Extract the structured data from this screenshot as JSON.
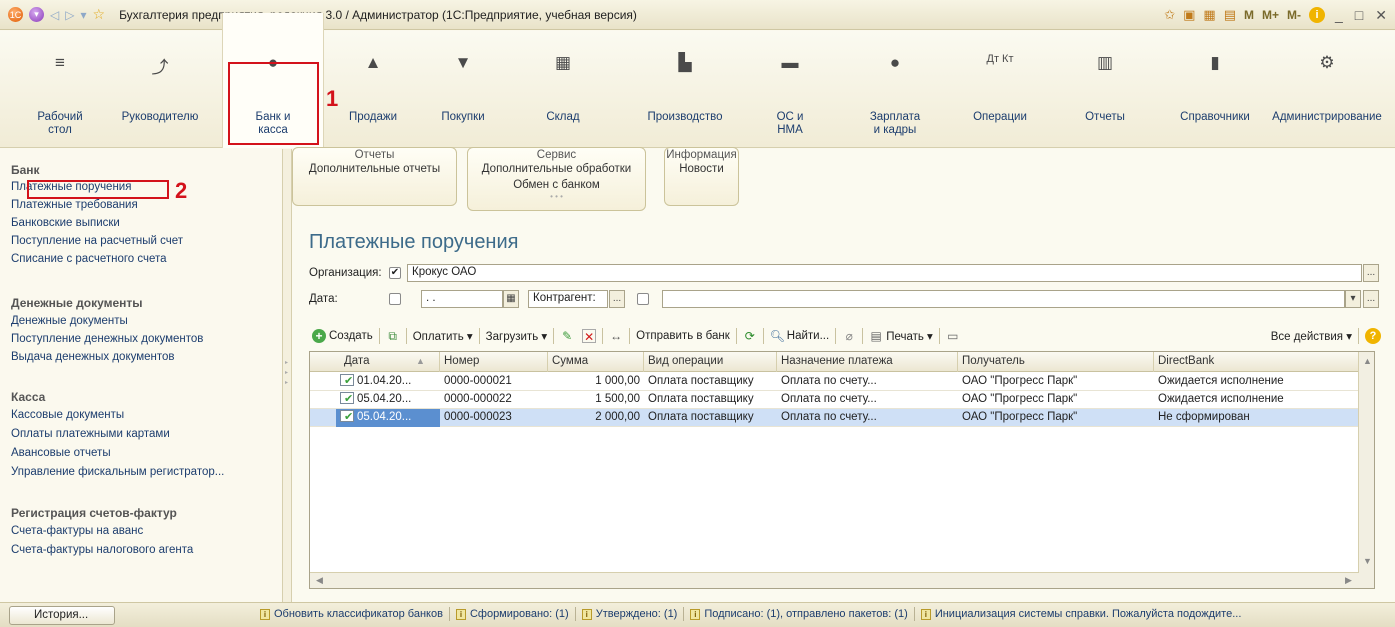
{
  "titlebar": {
    "title": "Бухгалтерия предприятия, редакция 3.0 / Администратор  (1С:Предприятие, учебная версия)",
    "right": [
      "М",
      "М+",
      "М-"
    ]
  },
  "sections": [
    {
      "label": "Рабочий\nстол",
      "icon": "list-icon"
    },
    {
      "label": "Руководителю",
      "icon": "chart-line-icon"
    },
    {
      "label": "Банк и\nкасса",
      "icon": "coin-icon"
    },
    {
      "label": "Продажи",
      "icon": "bag-icon"
    },
    {
      "label": "Покупки",
      "icon": "cart-icon"
    },
    {
      "label": "Склад",
      "icon": "warehouse-icon"
    },
    {
      "label": "Производство",
      "icon": "factory-icon"
    },
    {
      "label": "ОС и\nНМА",
      "icon": "truck-icon"
    },
    {
      "label": "Зарплата\nи кадры",
      "icon": "person-icon"
    },
    {
      "label": "Операции",
      "icon": "debit-credit-icon"
    },
    {
      "label": "Отчеты",
      "icon": "bar-chart-icon"
    },
    {
      "label": "Справочники",
      "icon": "book-icon"
    },
    {
      "label": "Администрирование",
      "icon": "gear-icon"
    }
  ],
  "annotations": {
    "n1": "1",
    "n2": "2"
  },
  "leftnav": {
    "groups": [
      {
        "title": "Банк",
        "items": [
          "Платежные поручения",
          "Платежные требования",
          "Банковские выписки",
          "Поступление на расчетный счет",
          "Списание с расчетного счета"
        ]
      },
      {
        "title": "Денежные документы",
        "items": [
          "Денежные документы",
          "Поступление денежных документов",
          "Выдача денежных документов"
        ]
      },
      {
        "title": "Касса",
        "items": [
          "Кассовые документы",
          "Оплаты платежными картами",
          "Авансовые отчеты",
          "Управление фискальным регистратор..."
        ]
      },
      {
        "title": "Регистрация счетов-фактур",
        "items": [
          "Счета-фактуры на аванс",
          "Счета-фактуры налогового агента"
        ]
      }
    ]
  },
  "commandGroups": [
    {
      "title": "Отчеты",
      "items": [
        "Дополнительные отчеты"
      ]
    },
    {
      "title": "Сервис",
      "items": [
        "Дополнительные обработки",
        "Обмен с банком"
      ]
    },
    {
      "title": "Информация",
      "items": [
        "Новости"
      ]
    }
  ],
  "form": {
    "title": "Платежные поручения",
    "org_label": "Организация:",
    "org_value": "Крокус ОАО",
    "date_label": "Дата:",
    "date_value": ". .",
    "contractor_label": "Контрагент:",
    "contractor_value": ""
  },
  "toolbar": {
    "create": "Создать",
    "pay": "Оплатить ▾",
    "load": "Загрузить ▾",
    "send": "Отправить в банк",
    "find": "Найти...",
    "print": "Печать ▾",
    "all": "Все действия ▾"
  },
  "table": {
    "columns": [
      "Дата",
      "Номер",
      "Сумма",
      "Вид операции",
      "Назначение платежа",
      "Получатель",
      "DirectBank"
    ],
    "rows": [
      {
        "date": "01.04.20...",
        "number": "0000-000021",
        "sum": "1 000,00",
        "op": "Оплата поставщику",
        "purpose": "Оплата по счету...",
        "recipient": "ОАО \"Прогресс Парк\"",
        "directbank": "Ожидается исполнение"
      },
      {
        "date": "05.04.20...",
        "number": "0000-000022",
        "sum": "1 500,00",
        "op": "Оплата поставщику",
        "purpose": "Оплата по счету...",
        "recipient": "ОАО \"Прогресс Парк\"",
        "directbank": "Ожидается исполнение"
      },
      {
        "date": "05.04.20...",
        "number": "0000-000023",
        "sum": "2 000,00",
        "op": "Оплата поставщику",
        "purpose": "Оплата по счету...",
        "recipient": "ОАО \"Прогресс Парк\"",
        "directbank": "Не сформирован"
      }
    ]
  },
  "status": {
    "history": "История...",
    "messages": [
      "Обновить классификатор банков",
      "Сформировано: (1)",
      "Утверждено: (1)",
      "Подписано: (1), отправлено пакетов: (1)",
      "Инициализация системы справки. Пожалуйста подождите..."
    ]
  },
  "colors": {
    "accent": "#3d6b8a",
    "link": "#1c3d6e",
    "annotation": "#d3121b",
    "selection": "#cfe0f6"
  }
}
